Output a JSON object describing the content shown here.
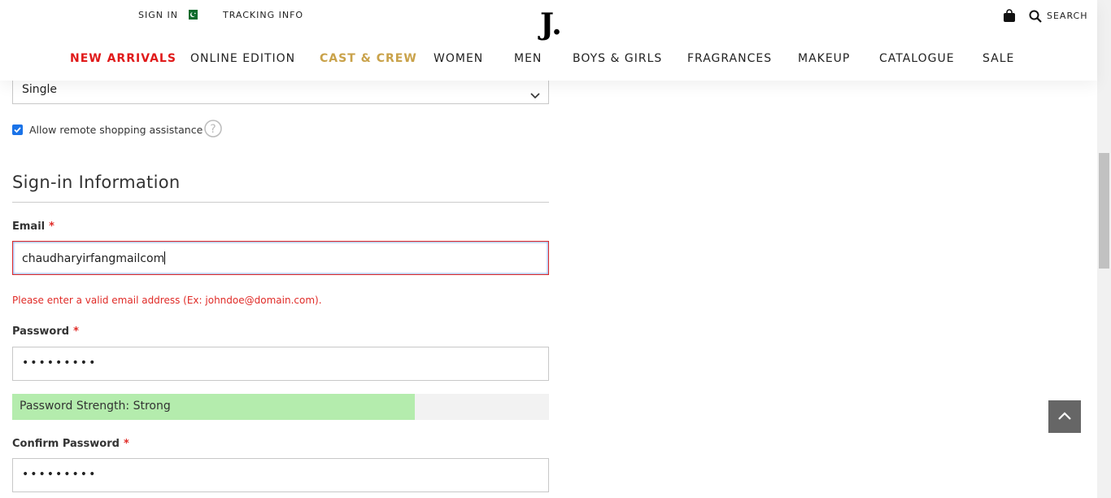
{
  "header": {
    "sign_in": "SIGN IN",
    "tracking": "TRACKING INFO",
    "logo": "J.",
    "search": "SEARCH",
    "flag_icon": "pakistan-flag-icon"
  },
  "nav": {
    "items": [
      {
        "label": "NEW ARRIVALS"
      },
      {
        "label": "ONLINE EDITION"
      },
      {
        "label": "CAST & CREW"
      },
      {
        "label": "WOMEN"
      },
      {
        "label": "MEN"
      },
      {
        "label": "BOYS & GIRLS"
      },
      {
        "label": "FRAGRANCES"
      },
      {
        "label": "MAKEUP"
      },
      {
        "label": "CATALOGUE"
      },
      {
        "label": "SALE"
      }
    ],
    "accent_red": "#e01a1a",
    "accent_gold": "#c9a24a"
  },
  "form": {
    "marital_status_value": "Single",
    "remote_assistance": {
      "label": "Allow remote shopping assistance",
      "checked": true
    },
    "section_title": "Sign-in Information",
    "email": {
      "label": "Email",
      "value": "chaudharyirfangmailcom",
      "error": "Please enter a valid email address (Ex: johndoe@domain.com)."
    },
    "password": {
      "label": "Password",
      "value": "•••••••••"
    },
    "strength": {
      "label": "Password Strength: Strong",
      "level": 0.75
    },
    "confirm_password": {
      "label": "Confirm Password",
      "value": "•••••••••"
    },
    "required_mark": "*"
  }
}
